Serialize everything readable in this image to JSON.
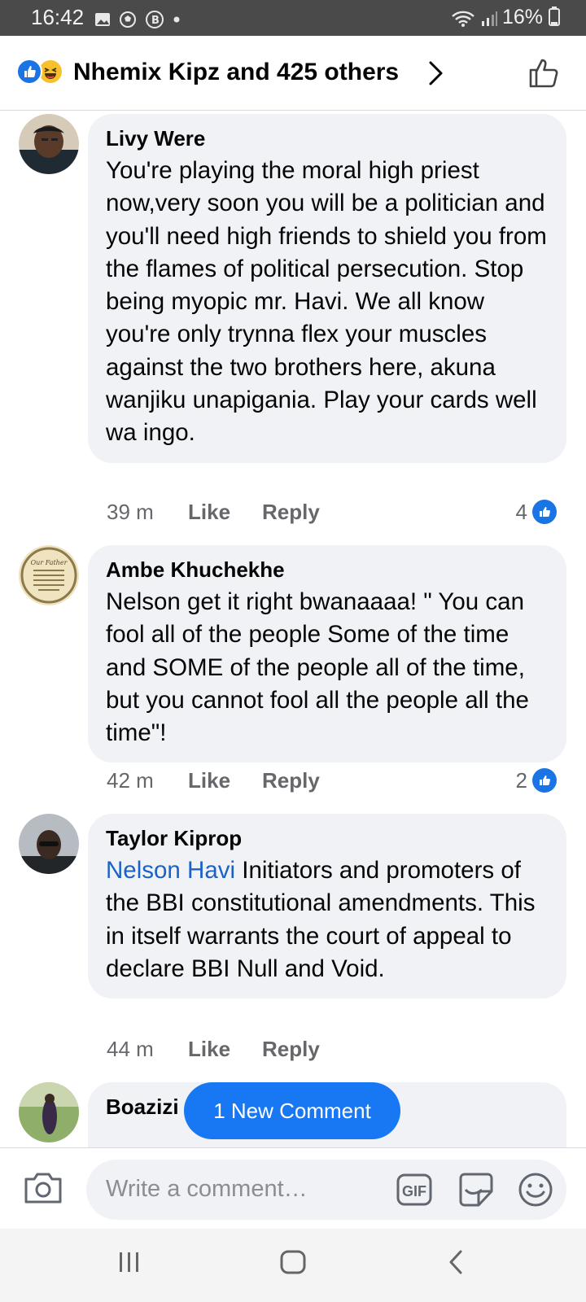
{
  "status_bar": {
    "time": "16:42",
    "battery": "16%"
  },
  "header": {
    "reactors": "Nhemix Kipz and 425 others"
  },
  "comments": [
    {
      "author": "Livy Were",
      "text": "You're playing the moral high priest now,very soon you will be a politician and you'll need high friends to shield you from the flames of political persecution. Stop being myopic mr. Havi. We all know you're only trynna flex your muscles against the two brothers here, akuna wanjiku unapigania. Play your cards well wa ingo.",
      "time": "39 m",
      "like_label": "Like",
      "reply_label": "Reply",
      "reactions": "4"
    },
    {
      "author": "Ambe Khuchekhe",
      "text": "Nelson get it right bwanaaaa! \" You can fool all of the people Some of the time and SOME of the people all of the time, but you cannot fool all the people all the time\"!",
      "time": "42 m",
      "like_label": "Like",
      "reply_label": "Reply",
      "reactions": "2",
      "avatar_text": "Our Father"
    },
    {
      "author": "Taylor Kiprop",
      "mention": "Nelson Havi",
      "text": " Initiators and promoters of the BBI constitutional amendments. This in itself warrants the court of appeal to declare BBI Null and  Void.",
      "time": "44 m",
      "like_label": "Like",
      "reply_label": "Reply"
    },
    {
      "author": "Boazizi"
    }
  ],
  "new_comment_pill": "1 New Comment",
  "composer": {
    "placeholder": "Write a comment…",
    "gif_label": "GIF"
  },
  "colors": {
    "accent": "#1877f2",
    "bubble": "#f0f2f5",
    "mention": "#1b62c7",
    "muted": "#65676b"
  }
}
